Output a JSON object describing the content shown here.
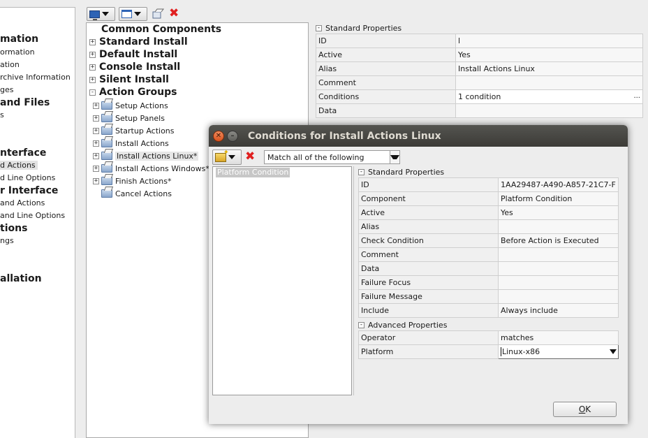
{
  "left_nav": {
    "items": [
      {
        "label": "mation",
        "style": "big"
      },
      {
        "label": "ormation",
        "style": "small"
      },
      {
        "label": "ation",
        "style": "small"
      },
      {
        "label": "rchive Information",
        "style": "small"
      },
      {
        "label": "ges",
        "style": "small"
      },
      {
        "label": "and Files",
        "style": "big"
      },
      {
        "label": "s",
        "style": "small"
      },
      {
        "label": "nterface",
        "style": "big"
      },
      {
        "label": "d Actions",
        "style": "small_selected"
      },
      {
        "label": "d Line Options",
        "style": "small"
      },
      {
        "label": "r Interface",
        "style": "big"
      },
      {
        "label": "and Actions",
        "style": "small"
      },
      {
        "label": "and Line Options",
        "style": "small"
      },
      {
        "label": "tions",
        "style": "big"
      },
      {
        "label": "ngs",
        "style": "small"
      },
      {
        "label": "allation",
        "style": "big"
      }
    ]
  },
  "toolbar": {
    "buttons": [
      {
        "icon": "monitor-icon",
        "has_dropdown": true
      },
      {
        "icon": "window-icon",
        "has_dropdown": true
      },
      {
        "icon": "copy-icon",
        "has_dropdown": false
      },
      {
        "icon": "delete-icon",
        "has_dropdown": false
      }
    ]
  },
  "tree": {
    "nodes": [
      {
        "label": "Common Components",
        "style": "big",
        "expander": false
      },
      {
        "label": "Standard Install",
        "style": "big",
        "expander": "+"
      },
      {
        "label": "Default Install",
        "style": "big",
        "expander": "+"
      },
      {
        "label": "Console Install",
        "style": "big",
        "expander": "+"
      },
      {
        "label": "Silent Install",
        "style": "big",
        "expander": "+"
      },
      {
        "label": "Action Groups",
        "style": "big",
        "expander": "-"
      },
      {
        "label": "Setup Actions",
        "style": "small",
        "expander": "+"
      },
      {
        "label": "Setup Panels",
        "style": "small",
        "expander": "+"
      },
      {
        "label": "Startup Actions",
        "style": "small",
        "expander": "+"
      },
      {
        "label": "Install Actions",
        "style": "small",
        "expander": "+"
      },
      {
        "label": "Install Actions Linux*",
        "style": "small",
        "expander": "+",
        "selected": true
      },
      {
        "label": "Install Actions Windows*",
        "style": "small",
        "expander": "+"
      },
      {
        "label": "Finish Actions*",
        "style": "small",
        "expander": "+"
      },
      {
        "label": "Cancel Actions",
        "style": "small",
        "expander": false
      }
    ]
  },
  "props": {
    "section_title": "Standard Properties",
    "rows": [
      {
        "key": "ID",
        "value": "l"
      },
      {
        "key": "Active",
        "value": "Yes"
      },
      {
        "key": "Alias",
        "value": "Install Actions Linux"
      },
      {
        "key": "Comment",
        "value": ""
      },
      {
        "key": "Conditions",
        "value": "1 condition",
        "ellipsis": "..."
      },
      {
        "key": "Data",
        "value": ""
      }
    ]
  },
  "dialog": {
    "title": "Conditions for Install Actions Linux",
    "close_symbol": "✕",
    "minimize_symbol": "–",
    "match_mode": "Match all of the following",
    "conditions": [
      "Platform Condition"
    ],
    "standard_section": "Standard Properties",
    "standard_rows": [
      {
        "key": "ID",
        "value": "1AA29487-A490-A857-21C7-F"
      },
      {
        "key": "Component",
        "value": "Platform Condition"
      },
      {
        "key": "Active",
        "value": "Yes"
      },
      {
        "key": "Alias",
        "value": ""
      },
      {
        "key": "Check Condition",
        "value": "Before Action is Executed"
      },
      {
        "key": "Comment",
        "value": ""
      },
      {
        "key": "Data",
        "value": ""
      },
      {
        "key": "Failure Focus",
        "value": ""
      },
      {
        "key": "Failure Message",
        "value": ""
      },
      {
        "key": "Include",
        "value": "Always include"
      }
    ],
    "advanced_section": "Advanced Properties",
    "advanced_rows": [
      {
        "key": "Operator",
        "value": "matches"
      },
      {
        "key": "Platform",
        "value": "Linux-x86"
      }
    ],
    "ok_label_underlined": "O",
    "ok_label_rest": "K"
  }
}
